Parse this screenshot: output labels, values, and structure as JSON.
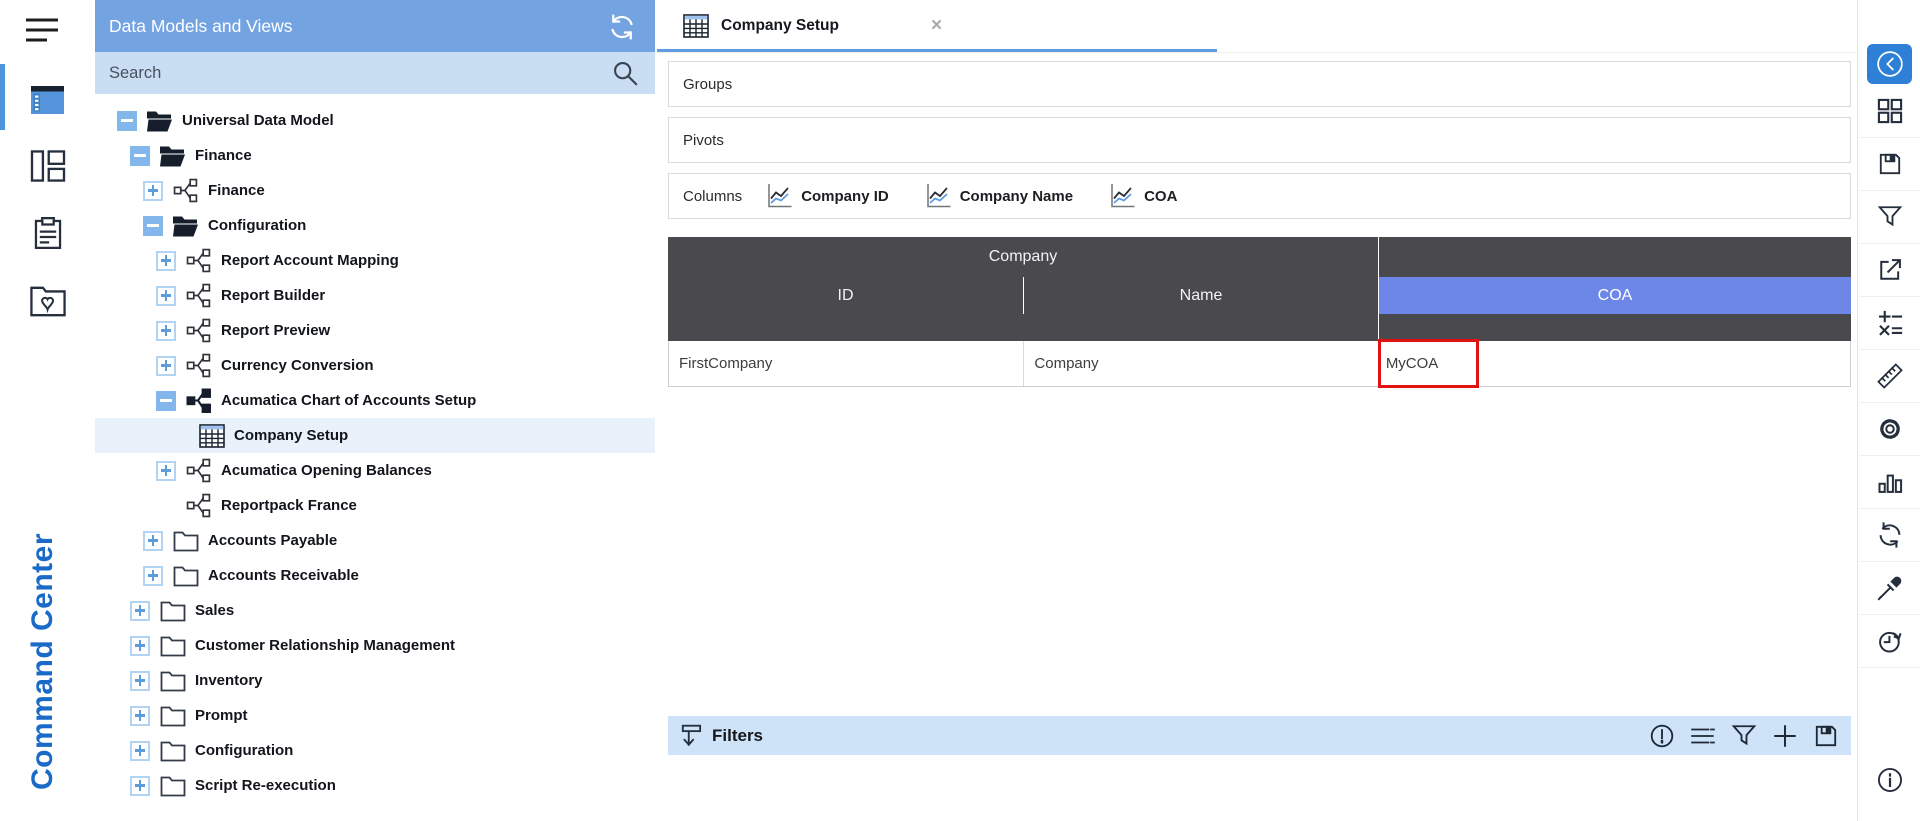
{
  "brand": {
    "vertical_text": "Command Center"
  },
  "left_rail": {
    "hamburger_icon": "hamburger",
    "items": [
      {
        "name": "data-models",
        "icon": "data-models",
        "active": true
      },
      {
        "name": "page-layout",
        "icon": "page-layout",
        "active": false
      },
      {
        "name": "clipboard",
        "icon": "clipboard",
        "active": false
      },
      {
        "name": "favorites-folder",
        "icon": "favorites-folder",
        "active": false
      }
    ]
  },
  "sidebar": {
    "title": "Data Models and Views",
    "refresh_icon": "refresh-white",
    "search_placeholder": "Search",
    "search_icon": "magnifier",
    "tree": [
      {
        "label": "Universal Data Model",
        "level": 0,
        "toggle": "minus",
        "icon": "folder-open",
        "selected": false
      },
      {
        "label": "Finance",
        "level": 1,
        "toggle": "minus",
        "icon": "folder-open",
        "selected": false
      },
      {
        "label": "Finance",
        "level": 2,
        "toggle": "plus",
        "icon": "model",
        "selected": false
      },
      {
        "label": "Configuration",
        "level": 2,
        "toggle": "minus",
        "icon": "folder-open",
        "selected": false
      },
      {
        "label": "Report Account Mapping",
        "level": 3,
        "toggle": "plus",
        "icon": "model",
        "selected": false
      },
      {
        "label": "Report Builder",
        "level": 3,
        "toggle": "plus",
        "icon": "model",
        "selected": false
      },
      {
        "label": "Report Preview",
        "level": 3,
        "toggle": "plus",
        "icon": "model",
        "selected": false
      },
      {
        "label": "Currency Conversion",
        "level": 3,
        "toggle": "plus",
        "icon": "model",
        "selected": false
      },
      {
        "label": "Acumatica Chart of Accounts Setup",
        "level": 3,
        "toggle": "minus",
        "icon": "model-filled",
        "selected": false
      },
      {
        "label": "Company Setup",
        "level": 4,
        "toggle": "none",
        "icon": "grid",
        "selected": true
      },
      {
        "label": "Acumatica Opening Balances",
        "level": 3,
        "toggle": "plus",
        "icon": "model",
        "selected": false
      },
      {
        "label": "Reportpack France",
        "level": 3,
        "toggle": "none",
        "icon": "model",
        "selected": false
      },
      {
        "label": "Accounts Payable",
        "level": 2,
        "toggle": "plus",
        "icon": "folder-closed",
        "selected": false
      },
      {
        "label": "Accounts Receivable",
        "level": 2,
        "toggle": "plus",
        "icon": "folder-closed",
        "selected": false
      },
      {
        "label": "Sales",
        "level": 1,
        "toggle": "plus",
        "icon": "folder-closed",
        "selected": false
      },
      {
        "label": "Customer Relationship Management",
        "level": 1,
        "toggle": "plus",
        "icon": "folder-closed",
        "selected": false
      },
      {
        "label": "Inventory",
        "level": 1,
        "toggle": "plus",
        "icon": "folder-closed",
        "selected": false
      },
      {
        "label": "Prompt",
        "level": 1,
        "toggle": "plus",
        "icon": "folder-closed",
        "selected": false
      },
      {
        "label": "Configuration",
        "level": 1,
        "toggle": "plus",
        "icon": "folder-closed",
        "selected": false
      },
      {
        "label": "Script Re-execution",
        "level": 1,
        "toggle": "plus",
        "icon": "folder-closed",
        "selected": false
      }
    ]
  },
  "tab": {
    "title": "Company Setup",
    "icon": "grid",
    "close_glyph": "×"
  },
  "panels": {
    "groups_label": "Groups",
    "pivots_label": "Pivots",
    "columns_label": "Columns"
  },
  "column_chips": [
    {
      "label": "Company ID",
      "icon": "line-chart"
    },
    {
      "label": "Company Name",
      "icon": "line-chart"
    },
    {
      "label": "COA",
      "icon": "line-chart"
    }
  ],
  "table": {
    "group_header": "Company",
    "sub_headers": [
      "ID",
      "Name",
      "COA"
    ],
    "highlighted_header": "COA",
    "rows": [
      {
        "cells": [
          "FirstCompany",
          "Company",
          "MyCOA"
        ],
        "selected_cell_index": 2
      }
    ]
  },
  "filters_bar": {
    "label": "Filters",
    "left_icon": "filter-down",
    "right_icons": [
      "alert-circle",
      "list",
      "filter",
      "plus",
      "save"
    ]
  },
  "right_rail": {
    "icons": [
      "collapse-panel",
      "grid-layout",
      "save",
      "filter",
      "export-share",
      "calculations",
      "ruler",
      "settings",
      "chart",
      "refresh",
      "eyedropper",
      "history",
      "info"
    ]
  },
  "colors": {
    "sidebar_header_blue": "#74A3E2",
    "search_blue": "#C9DDF3",
    "selected_row_blue": "#E9F2FB",
    "table_header_gray": "#4A494E",
    "coa_highlight_blue": "#6D87E9",
    "filters_bar_blue": "#CFE3F8",
    "accent_blue": "#2E7FD6",
    "tab_underline_blue": "#5E9CE4",
    "selection_red": "#E01212",
    "brand_blue": "#1A6AC8"
  }
}
